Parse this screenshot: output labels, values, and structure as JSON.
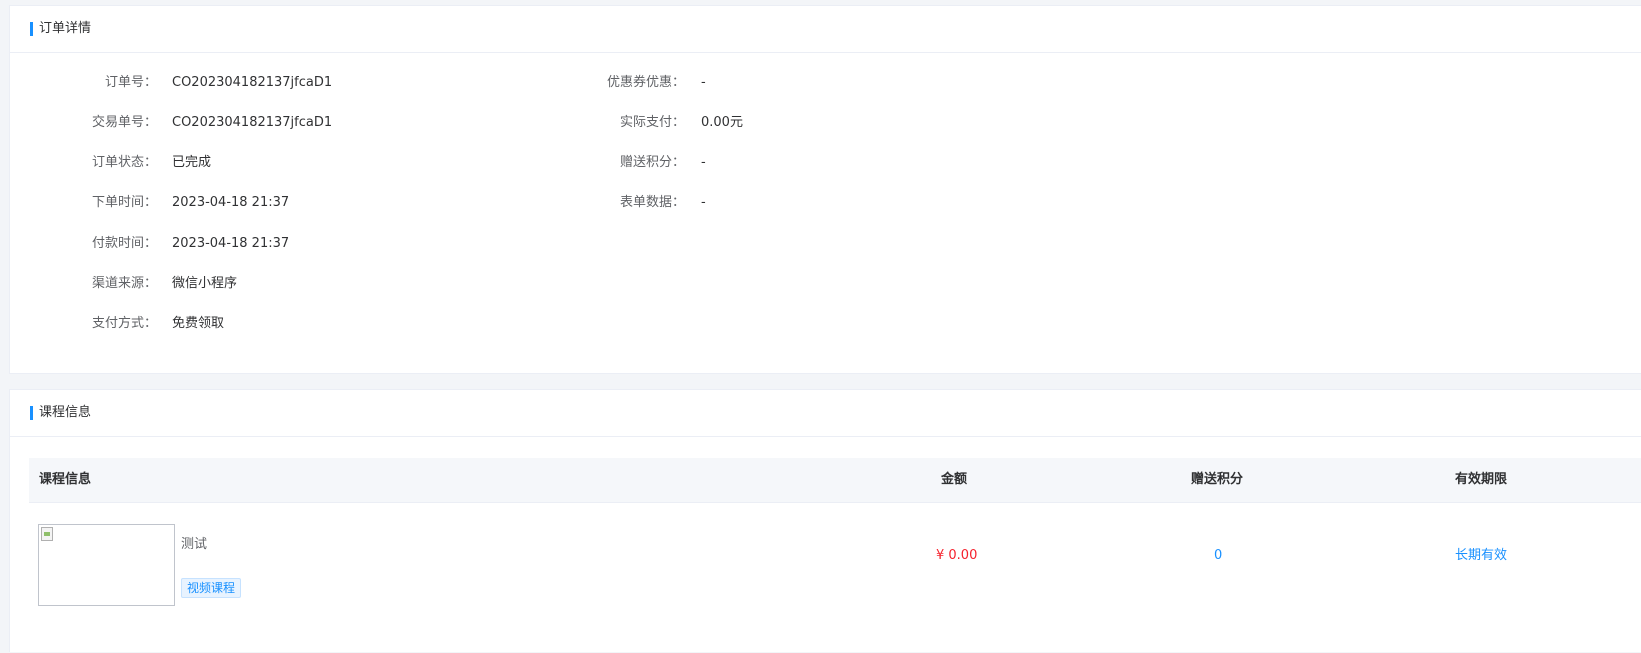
{
  "order_card": {
    "title": "订单详情",
    "left_fields": [
      {
        "label": "订单号：",
        "value": "CO202304182137jfcaD1"
      },
      {
        "label": "交易单号：",
        "value": "CO202304182137jfcaD1"
      },
      {
        "label": "订单状态：",
        "value": "已完成"
      },
      {
        "label": "下单时间：",
        "value": "2023-04-18 21:37"
      },
      {
        "label": "付款时间：",
        "value": "2023-04-18 21:37"
      },
      {
        "label": "渠道来源：",
        "value": "微信小程序"
      },
      {
        "label": "支付方式：",
        "value": "免费领取"
      }
    ],
    "right_fields": [
      {
        "label": "优惠券优惠：",
        "value": "-"
      },
      {
        "label": "实际支付：",
        "value": "0.00元"
      },
      {
        "label": "赠送积分：",
        "value": "-"
      },
      {
        "label": "表单数据：",
        "value": "-"
      }
    ]
  },
  "course_card": {
    "title": "课程信息",
    "table": {
      "headers": [
        "课程信息",
        "金额",
        "赠送积分",
        "有效期限"
      ],
      "rows": [
        {
          "name": "测试",
          "tag": "视频课程",
          "amount": "¥ 0.00",
          "points": "0",
          "validity": "长期有效"
        }
      ]
    }
  },
  "colors": {
    "accent": "#1890ff",
    "price": "#f5222d",
    "header_bg": "#f5f7fa",
    "page_bg": "#f3f5f8"
  }
}
